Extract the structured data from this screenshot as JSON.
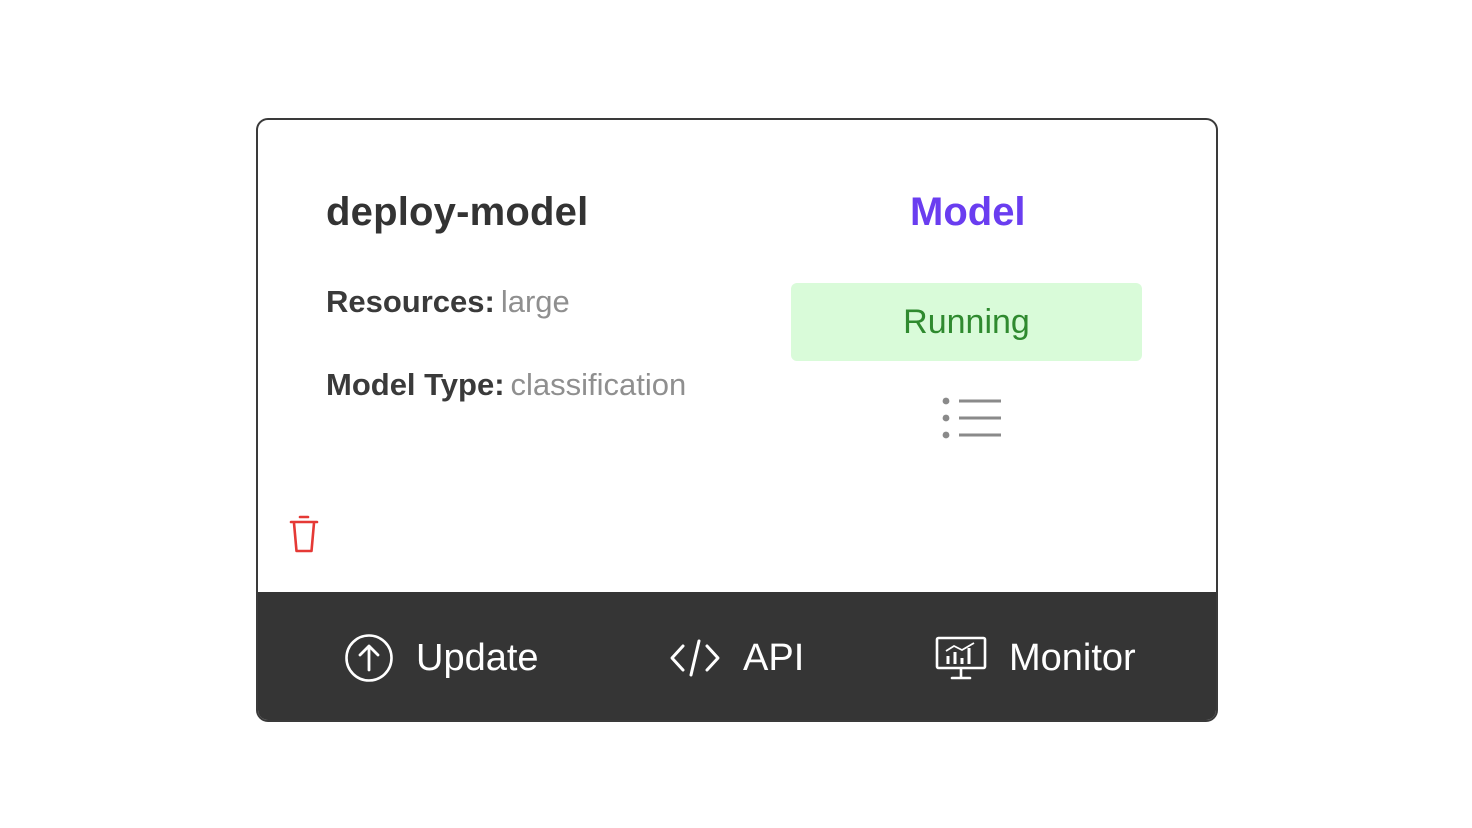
{
  "card": {
    "name": "deploy-model",
    "kind": "Model",
    "kind_color": "#6a3df0",
    "info": [
      {
        "key": "Resources:",
        "value": "large"
      },
      {
        "key": "Model Type:",
        "value": "classification"
      }
    ],
    "status": {
      "label": "Running",
      "bg_color": "#d9fbd9",
      "text_color": "#2f8a2f"
    },
    "icons": {
      "list": "list-icon",
      "delete": "trash-icon",
      "delete_color": "#e53935"
    }
  },
  "footer": {
    "background": "#353535",
    "actions": [
      {
        "label": "Update",
        "icon": "upload-circle-icon"
      },
      {
        "label": "API",
        "icon": "code-icon"
      },
      {
        "label": "Monitor",
        "icon": "monitor-chart-icon"
      }
    ]
  }
}
